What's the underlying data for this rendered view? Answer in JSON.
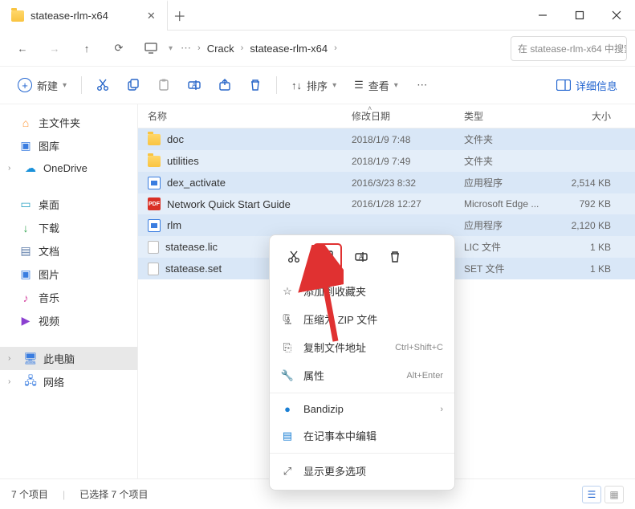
{
  "tab": {
    "title": "statease-rlm-x64"
  },
  "breadcrumb": {
    "items": [
      "Crack",
      "statease-rlm-x64"
    ]
  },
  "search": {
    "placeholder": "在 statease-rlm-x64 中搜索"
  },
  "toolbar": {
    "new": "新建",
    "sort": "排序",
    "view": "查看",
    "details": "详细信息"
  },
  "sidebar": {
    "home": "主文件夹",
    "gallery": "图库",
    "onedrive": "OneDrive",
    "desktop": "桌面",
    "downloads": "下载",
    "documents": "文档",
    "pictures": "图片",
    "music": "音乐",
    "videos": "视频",
    "thispc": "此电脑",
    "network": "网络"
  },
  "columns": {
    "name": "名称",
    "date": "修改日期",
    "type": "类型",
    "size": "大小"
  },
  "rows": [
    {
      "name": "doc",
      "date": "2018/1/9 7:48",
      "type": "文件夹",
      "size": "",
      "icon": "folder"
    },
    {
      "name": "utilities",
      "date": "2018/1/9 7:49",
      "type": "文件夹",
      "size": "",
      "icon": "folder"
    },
    {
      "name": "dex_activate",
      "date": "2016/3/23 8:32",
      "type": "应用程序",
      "size": "2,514 KB",
      "icon": "exe"
    },
    {
      "name": "Network Quick Start Guide",
      "date": "2016/1/28 12:27",
      "type": "Microsoft Edge ...",
      "size": "792 KB",
      "icon": "pdf"
    },
    {
      "name": "rlm",
      "date": "",
      "type": "应用程序",
      "size": "2,120 KB",
      "icon": "exe"
    },
    {
      "name": "statease.lic",
      "date": "",
      "type": "LIC 文件",
      "size": "1 KB",
      "icon": "file"
    },
    {
      "name": "statease.set",
      "date": "",
      "type": "SET 文件",
      "size": "1 KB",
      "icon": "file"
    }
  ],
  "context": {
    "fav": "添加到收藏夹",
    "zip": "压缩为 ZIP 文件",
    "copypath": "复制文件地址",
    "copypath_sc": "Ctrl+Shift+C",
    "props": "属性",
    "props_sc": "Alt+Enter",
    "bandizip": "Bandizip",
    "notepad": "在记事本中编辑",
    "more": "显示更多选项"
  },
  "status": {
    "count": "7 个项目",
    "selected": "已选择 7 个项目"
  }
}
